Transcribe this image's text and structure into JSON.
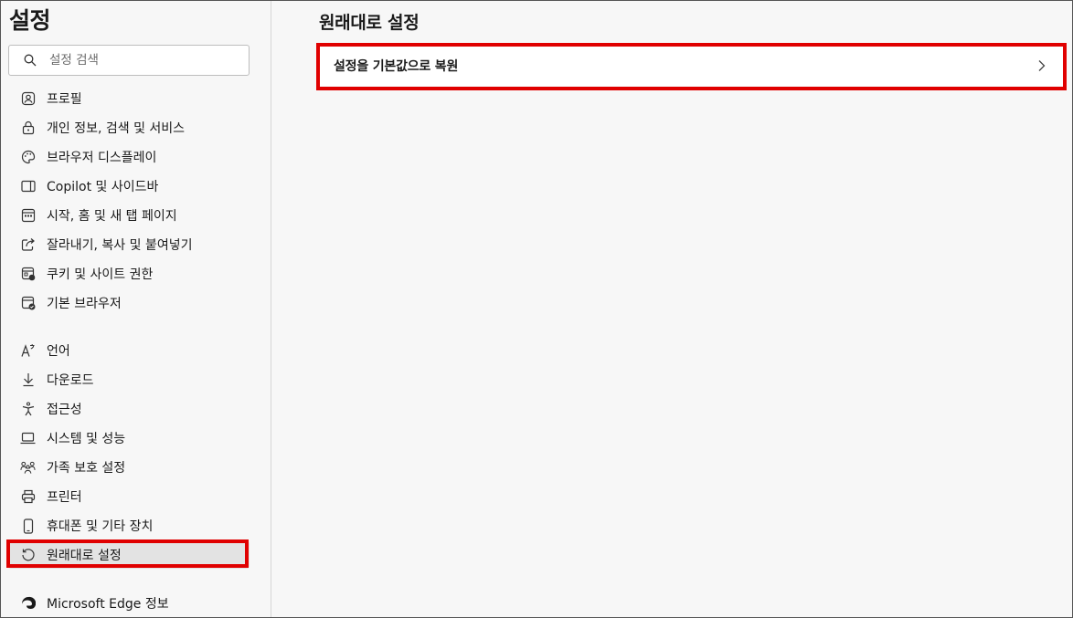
{
  "sidebar": {
    "title": "설정",
    "search": {
      "placeholder": "설정 검색",
      "value": ""
    },
    "items": [
      {
        "label": "프로필",
        "icon": "profile-icon"
      },
      {
        "label": "개인 정보, 검색 및 서비스",
        "icon": "lock-icon"
      },
      {
        "label": "브라우저 디스플레이",
        "icon": "palette-icon"
      },
      {
        "label": "Copilot 및 사이드바",
        "icon": "sidebar-icon"
      },
      {
        "label": "시작, 홈 및 새 탭 페이지",
        "icon": "home-page-icon"
      },
      {
        "label": "잘라내기, 복사 및 붙여넣기",
        "icon": "share-icon"
      },
      {
        "label": "쿠키 및 사이트 권한",
        "icon": "cookie-permissions-icon"
      },
      {
        "label": "기본 브라우저",
        "icon": "default-browser-icon"
      },
      {
        "label": "언어",
        "icon": "language-icon"
      },
      {
        "label": "다운로드",
        "icon": "download-icon"
      },
      {
        "label": "접근성",
        "icon": "accessibility-icon"
      },
      {
        "label": "시스템 및 성능",
        "icon": "laptop-icon"
      },
      {
        "label": "가족 보호 설정",
        "icon": "family-icon"
      },
      {
        "label": "프린터",
        "icon": "printer-icon"
      },
      {
        "label": "휴대폰 및 기타 장치",
        "icon": "phone-icon"
      },
      {
        "label": "원래대로 설정",
        "icon": "reset-icon",
        "selected": true
      },
      {
        "label": "Microsoft Edge 정보",
        "icon": "edge-logo-icon"
      }
    ]
  },
  "main": {
    "title": "원래대로 설정",
    "reset_option": {
      "label": "설정을 기본값으로 복원",
      "icon": "chevron-right-icon"
    }
  },
  "colors": {
    "highlight": "#e00000",
    "background": "#f7f7f7",
    "selected": "#e3e3e3"
  }
}
